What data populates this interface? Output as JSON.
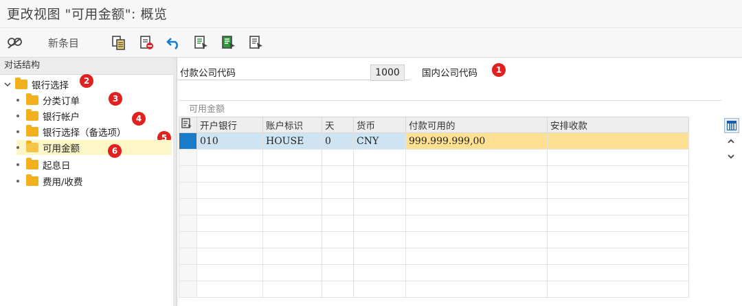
{
  "window": {
    "title": "更改视图 \"可用金额\": 概览"
  },
  "toolbar": {
    "new_entries_label": "新条目"
  },
  "dialog_structure": {
    "title": "对话结构",
    "root": {
      "label": "银行选择",
      "marker": "2"
    },
    "items": [
      {
        "label": "分类订单",
        "marker": "3"
      },
      {
        "label": "银行帐户",
        "marker": "4"
      },
      {
        "label": "银行选择（备选项）",
        "marker": "5"
      },
      {
        "label": "可用金额",
        "marker": "6"
      },
      {
        "label": "起息日"
      },
      {
        "label": "费用/收费"
      }
    ]
  },
  "header_fields": {
    "company_code_label": "付款公司代码",
    "company_code_value": "1000",
    "company_code_desc": "国内公司代码",
    "marker": "1"
  },
  "table": {
    "group_title": "可用金额",
    "columns": [
      "开户银行",
      "账户标识",
      "天",
      "货币",
      "付款可用的",
      "安排收款"
    ],
    "rows": [
      [
        "010",
        "HOUSE",
        "0",
        "CNY",
        "999.999.999,00",
        ""
      ]
    ]
  },
  "colors": {
    "marker": "#e1211f",
    "selected_row": "#cfe4f3",
    "highlight": "#fde092",
    "folder": "#f2b01e"
  }
}
